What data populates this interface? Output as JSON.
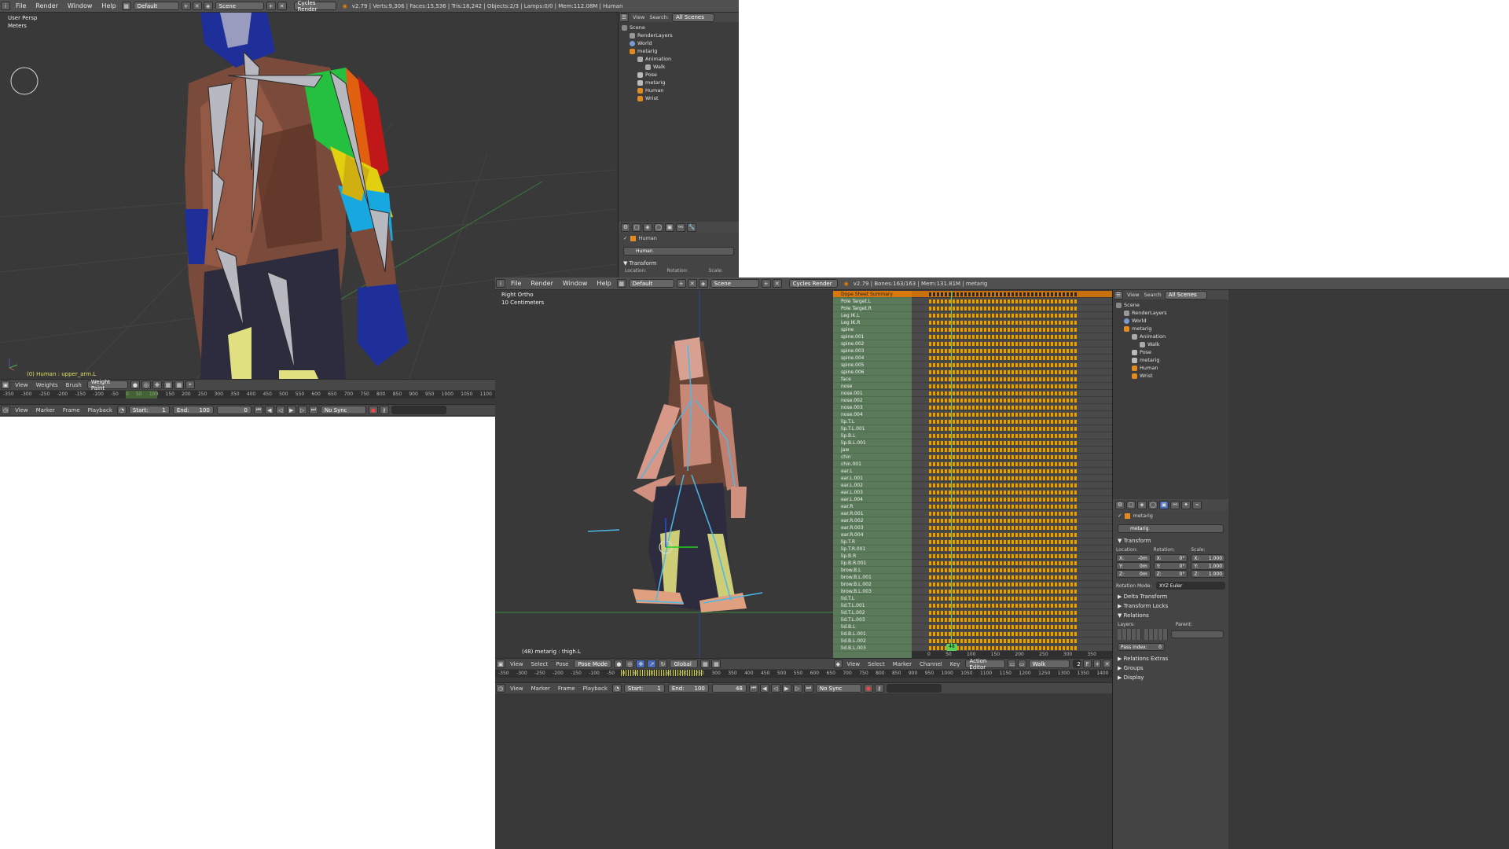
{
  "left_window": {
    "menus": [
      "File",
      "Render",
      "Window",
      "Help"
    ],
    "layout": "Default",
    "scene": "Scene",
    "engine": "Cycles Render",
    "info": "v2.79 | Verts:9,306 | Faces:15,536 | Tris:18,242 | Objects:2/3 | Lamps:0/0 | Mem:112.08M | Human",
    "viewport": {
      "view_name": "User Persp",
      "units": "Meters",
      "object_info": "(0) Human : upper_arm.L"
    },
    "viewport_header": {
      "menus": [
        "View",
        "Weights",
        "Brush"
      ],
      "mode": "Weight Paint"
    },
    "ruler_ticks": [
      "-350",
      "-300",
      "-250",
      "-200",
      "-150",
      "-100",
      "-50",
      "0",
      "50",
      "100",
      "150",
      "200",
      "250",
      "300",
      "350",
      "400",
      "450",
      "500",
      "550",
      "600",
      "650",
      "700",
      "750",
      "800",
      "850",
      "900",
      "950",
      "1000",
      "1050",
      "1100"
    ],
    "timeline_header": {
      "menus": [
        "View",
        "Marker",
        "Frame",
        "Playback"
      ],
      "start_label": "Start:",
      "start": "1",
      "end_label": "End:",
      "end": "100",
      "current": "0",
      "sync": "No Sync"
    },
    "outliner": {
      "menus": [
        "View",
        "Search:"
      ],
      "filter": "All Scenes",
      "items": [
        "Scene",
        "RenderLayers",
        "World",
        "metarig",
        "Animation",
        "Walk",
        "Pose",
        "metarig",
        "Human",
        "Wrist"
      ]
    },
    "properties": {
      "object": "Human",
      "name": "Human",
      "section": "Transform",
      "labels": [
        "Location:",
        "Rotation:",
        "Scale:"
      ]
    }
  },
  "right_window": {
    "menus": [
      "File",
      "Render",
      "Window",
      "Help"
    ],
    "layout": "Default",
    "scene": "Scene",
    "engine": "Cycles Render",
    "info": "v2.79 | Bones:163/163 | Mem:131.81M | metarig",
    "viewport": {
      "view_name": "Right Ortho",
      "units": "10 Centimeters",
      "object_info": "(48) metarig : thigh.L"
    },
    "viewport_header": {
      "menus": [
        "View",
        "Select",
        "Pose"
      ],
      "mode": "Pose Mode",
      "orientation": "Global"
    },
    "dopesheet": {
      "summary": "Dope Sheet Summary",
      "channels": [
        "Pole Target.L",
        "Pole Target.R",
        "Leg IK.L",
        "Leg IK.R",
        "spine",
        "spine.001",
        "spine.002",
        "spine.003",
        "spine.004",
        "spine.005",
        "spine.006",
        "face",
        "nose",
        "nose.001",
        "nose.002",
        "nose.003",
        "nose.004",
        "lip.T.L",
        "lip.T.L.001",
        "lip.B.L",
        "lip.B.L.001",
        "jaw",
        "chin",
        "chin.001",
        "ear.L",
        "ear.L.001",
        "ear.L.002",
        "ear.L.003",
        "ear.L.004",
        "ear.R",
        "ear.R.001",
        "ear.R.002",
        "ear.R.003",
        "ear.R.004",
        "lip.T.R",
        "lip.T.R.001",
        "lip.B.R",
        "lip.B.R.001",
        "brow.B.L",
        "brow.B.L.001",
        "brow.B.L.002",
        "brow.B.L.003",
        "lid.T.L",
        "lid.T.L.001",
        "lid.T.L.002",
        "lid.T.L.003",
        "lid.B.L",
        "lid.B.L.001",
        "lid.B.L.002",
        "lid.B.L.003"
      ],
      "ticks": [
        "0",
        "50",
        "100",
        "150",
        "200",
        "250",
        "300",
        "350"
      ],
      "current_frame": "48",
      "header_menus": [
        "View",
        "Select",
        "Marker",
        "Channel",
        "Key"
      ],
      "editor": "Action Editor",
      "action": "Walk",
      "users": "2"
    },
    "ruler_ticks": [
      "-350",
      "-300",
      "-250",
      "-200",
      "-150",
      "-100",
      "-50",
      "0",
      "50",
      "100",
      "150",
      "200",
      "250",
      "300",
      "350",
      "400",
      "450",
      "500",
      "550",
      "600",
      "650",
      "700",
      "750",
      "800",
      "850",
      "900",
      "950",
      "1000",
      "1050",
      "1100",
      "1150",
      "1200",
      "1250",
      "1300",
      "1350",
      "1400"
    ],
    "timeline_header": {
      "menus": [
        "View",
        "Marker",
        "Frame",
        "Playback"
      ],
      "start_label": "Start:",
      "start": "1",
      "end_label": "End:",
      "end": "100",
      "current": "48",
      "sync": "No Sync"
    },
    "outliner": {
      "menus": [
        "View",
        "Search"
      ],
      "filter": "All Scenes",
      "items": [
        "Scene",
        "RenderLayers",
        "World",
        "metarig",
        "Animation",
        "Walk",
        "Pose",
        "metarig",
        "Human",
        "Wrist"
      ]
    },
    "properties": {
      "object": "metarig",
      "name": "metarig",
      "section": "Transform",
      "location_label": "Location:",
      "rotation_label": "Rotation:",
      "scale_label": "Scale:",
      "loc": [
        "X:",
        "-0m",
        "Y:",
        "0m",
        "Z:",
        "0m"
      ],
      "rot": [
        "X:",
        "0°",
        "Y:",
        "0°",
        "Z:",
        "0°"
      ],
      "scale": [
        "X:",
        "1.000",
        "Y:",
        "1.000",
        "Z:",
        "1.000"
      ],
      "rotation_mode_label": "Rotation Mode:",
      "rotation_mode": "XYZ Euler",
      "sections": [
        "Delta Transform",
        "Transform Locks",
        "Relations"
      ],
      "layers_label": "Layers:",
      "parent_label": "Parent:",
      "pass_index": "Pass Index:",
      "pass_value": "0",
      "more_sections": [
        "Relations Extras",
        "Groups",
        "Display"
      ]
    }
  },
  "colors": {
    "panel_bg": "#393939",
    "header_bg": "#484848",
    "channel_green": "#5a7a5a",
    "summary_orange": "#d8780d",
    "keyframe": "#e8a000",
    "frame_marker": "#5ad05a"
  }
}
